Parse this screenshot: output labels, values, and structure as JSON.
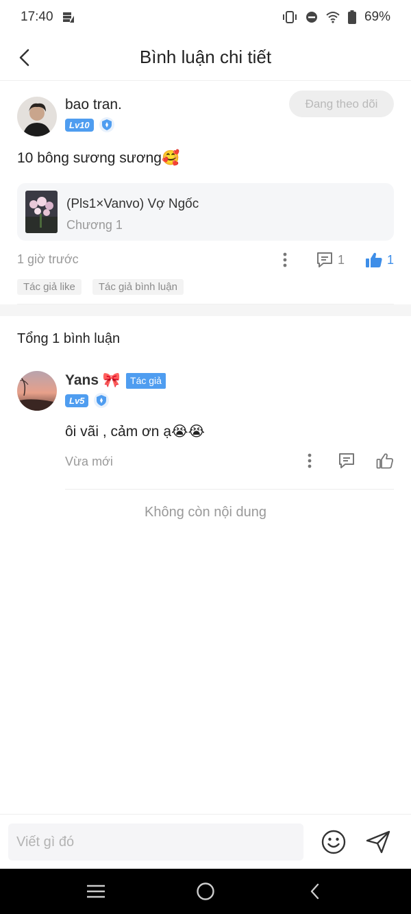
{
  "status_bar": {
    "time": "17:40",
    "battery": "69%",
    "icons": [
      "data-saver-icon",
      "vibrate-icon",
      "do-not-disturb-icon",
      "wifi-icon",
      "battery-icon"
    ]
  },
  "header": {
    "title": "Bình luận chi tiết",
    "back_icon": "chevron-left-icon"
  },
  "post": {
    "author_name": "bao tran.",
    "level": "Lv10",
    "follow_label": "Đang theo dõi",
    "text": "10 bông sương sương🥰",
    "book": {
      "title": "(Pls1×Vanvo) Vợ Ngốc",
      "chapter": "Chương 1"
    },
    "time": "1 giờ trước",
    "comment_count": "1",
    "like_count": "1",
    "tags": [
      "Tác giả like",
      "Tác giả bình luận"
    ]
  },
  "comments": {
    "total_label": "Tổng 1 bình luận",
    "items": [
      {
        "name": "Yans 🎀",
        "author_tag": "Tác giả",
        "level": "Lv5",
        "text": "ôi vãi , cảm ơn ạ😭😭",
        "time": "Vừa mới"
      }
    ],
    "no_more": "Không còn nội dung"
  },
  "input": {
    "placeholder": "Viết gì đó"
  },
  "colors": {
    "accent": "#4f9df0",
    "like_active": "#3e8ee8",
    "muted_text": "#999999",
    "nav_bar": "#000000"
  }
}
